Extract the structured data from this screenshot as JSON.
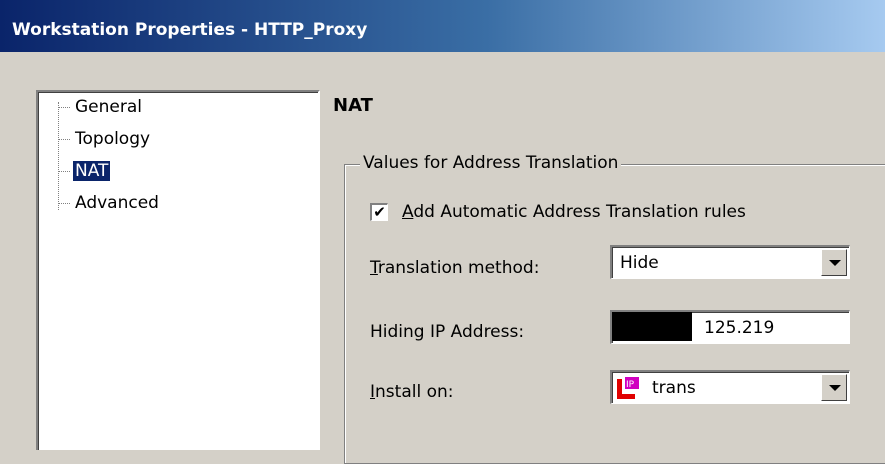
{
  "window": {
    "title": "Workstation Properties - HTTP_Proxy"
  },
  "tree": {
    "items": [
      {
        "label": "General",
        "selected": false
      },
      {
        "label": "Topology",
        "selected": false
      },
      {
        "label": "NAT",
        "selected": true
      },
      {
        "label": "Advanced",
        "selected": false
      }
    ]
  },
  "nat": {
    "section_title": "NAT",
    "group_label": "Values for  Address Translation",
    "auto_rules": {
      "label": "Add Automatic Address Translation rules",
      "checked": true
    },
    "translation_method": {
      "label": "Translation method:",
      "value": "Hide"
    },
    "hiding_ip": {
      "label": "Hiding IP Address:",
      "value": "125.219"
    },
    "install_on": {
      "label": "Install on:",
      "value": "trans",
      "icon": "gateway-icon"
    }
  }
}
